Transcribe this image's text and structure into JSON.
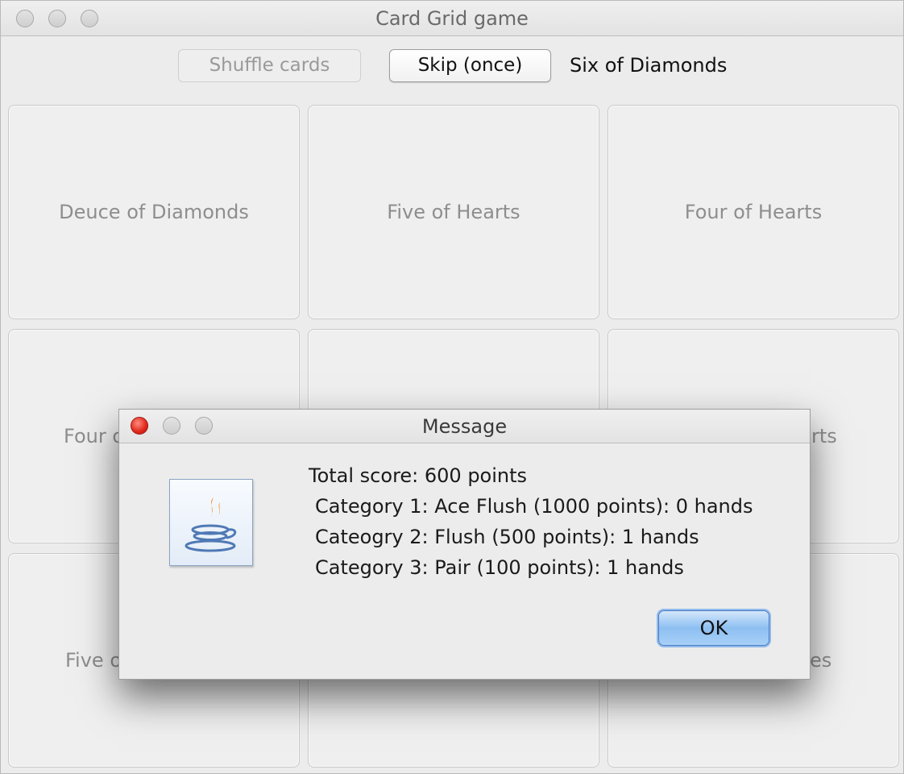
{
  "window": {
    "title": "Card Grid game"
  },
  "toolbar": {
    "shuffle_label": "Shuffle cards",
    "skip_label": "Skip (once)",
    "current_card": "Six of Diamonds"
  },
  "grid": {
    "cells": [
      {
        "label": "Deuce of Diamonds"
      },
      {
        "label": "Five of Hearts"
      },
      {
        "label": "Four of Hearts"
      },
      {
        "label": "Four o"
      },
      {
        "label": ""
      },
      {
        "label": "rts"
      },
      {
        "label": "Five o"
      },
      {
        "label": ""
      },
      {
        "label": "es"
      }
    ]
  },
  "dialog": {
    "title": "Message",
    "icon": "java-coffee-icon",
    "lines": [
      "Total score: 600 points",
      "Category 1: Ace Flush (1000 points): 0 hands",
      "Cateogry 2: Flush (500 points): 1 hands",
      "Category 3: Pair (100 points): 1 hands"
    ],
    "ok_label": "OK"
  },
  "colors": {
    "close_button": "#e0261a",
    "ok_button": "#8dbff2"
  }
}
